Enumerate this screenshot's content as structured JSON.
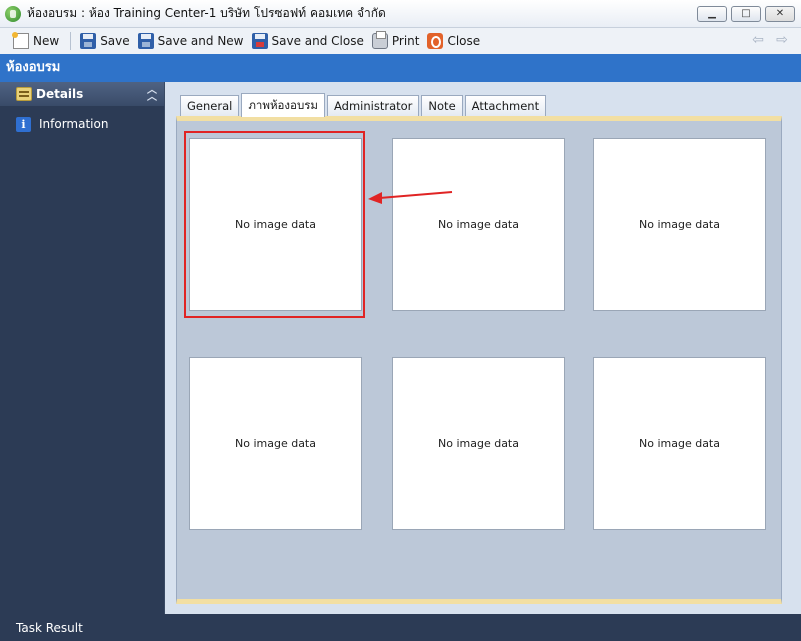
{
  "window": {
    "title": "ห้องอบรม : ห้อง Training Center-1 บริษัท โปรซอฟท์ คอมเทค จำกัด"
  },
  "toolbar": {
    "new_label": "New",
    "save_label": "Save",
    "save_new_label": "Save and New",
    "save_close_label": "Save and Close",
    "print_label": "Print",
    "close_label": "Close"
  },
  "form": {
    "header": "ห้องอบรม"
  },
  "sidebar": {
    "group_label": "Details",
    "items": [
      {
        "label": "Information",
        "icon": "info-icon"
      }
    ]
  },
  "tabs": [
    {
      "label": "General",
      "active": false
    },
    {
      "label": "ภาพห้องอบรม",
      "active": true
    },
    {
      "label": "Administrator",
      "active": false
    },
    {
      "label": "Note",
      "active": false
    },
    {
      "label": "Attachment",
      "active": false
    }
  ],
  "images": [
    {
      "placeholder": "No image data"
    },
    {
      "placeholder": "No image data"
    },
    {
      "placeholder": "No image data"
    },
    {
      "placeholder": "No image data"
    },
    {
      "placeholder": "No image data"
    },
    {
      "placeholder": "No image data"
    }
  ],
  "annotation": {
    "color": "#e02424"
  },
  "status": {
    "text": "Task Result"
  },
  "colors": {
    "header_blue": "#2f73c9",
    "nav_dark": "#2c3b55",
    "panel_border": "#f2dfa3"
  }
}
